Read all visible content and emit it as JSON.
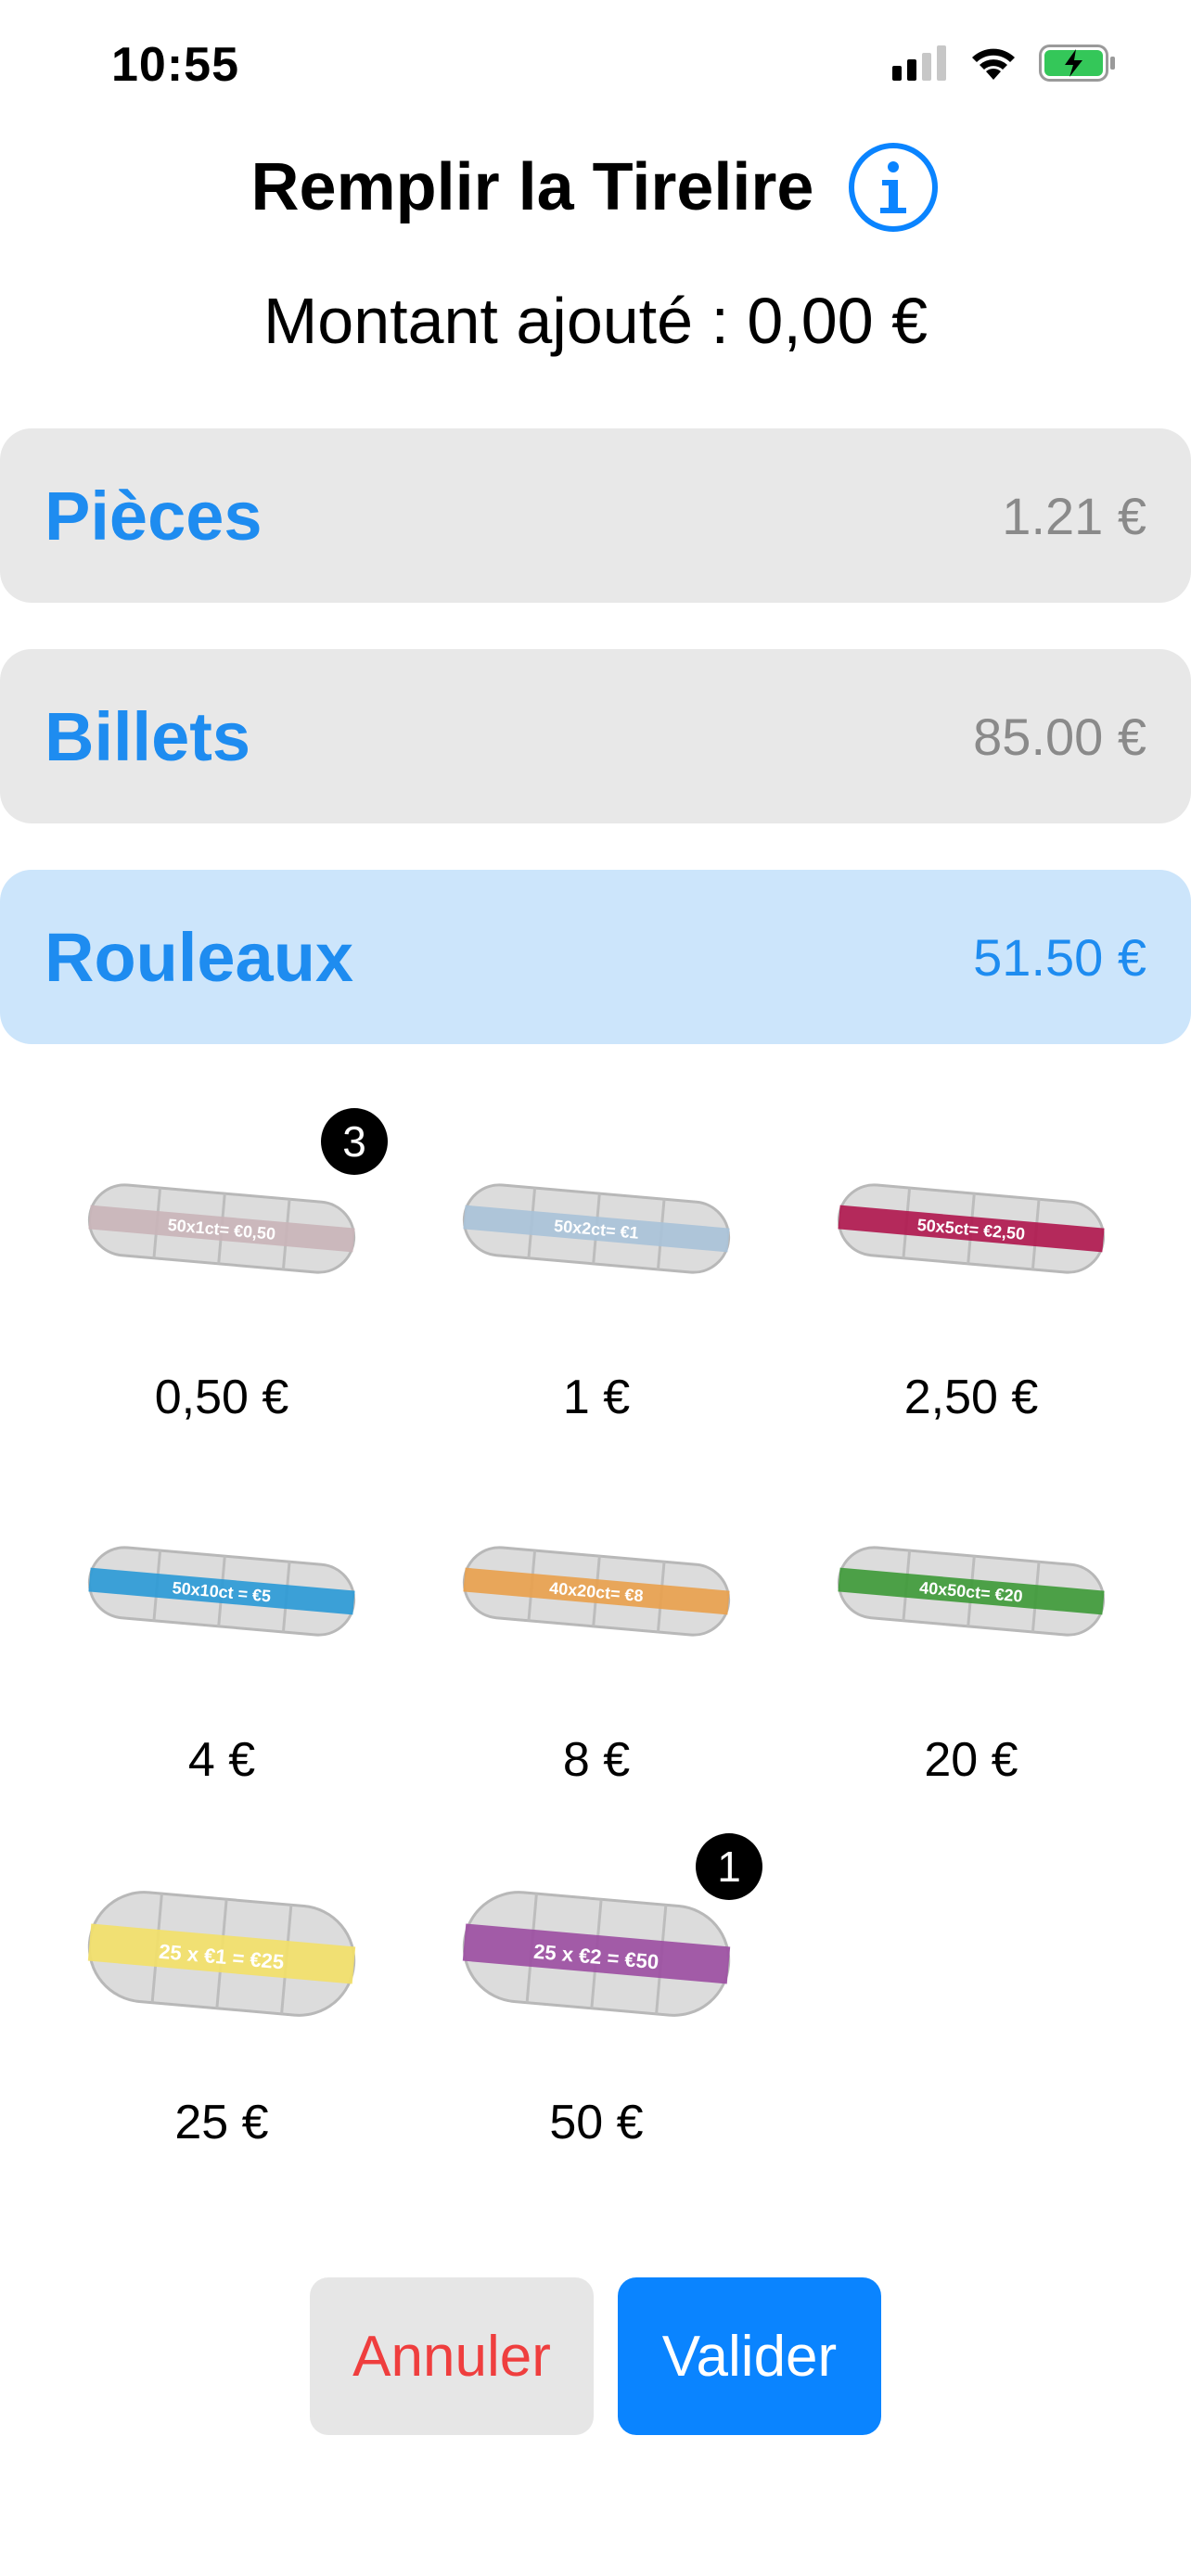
{
  "status_bar": {
    "time": "10:55"
  },
  "header": {
    "title": "Remplir la Tirelire",
    "amount_label": "Montant ajouté : 0,00 €"
  },
  "categories": [
    {
      "label": "Pièces",
      "amount": "1.21 €",
      "active": false
    },
    {
      "label": "Billets",
      "amount": "85.00 €",
      "active": false
    },
    {
      "label": "Rouleaux",
      "amount": "51.50 €",
      "active": true
    }
  ],
  "rolls": [
    {
      "label": "0,50 €",
      "band_color": "#c9b4b8",
      "band_text": "50x1ct= €0,50",
      "badge": "3"
    },
    {
      "label": "1 €",
      "band_color": "#a9c2d8",
      "band_text": "50x2ct= €1",
      "badge": null
    },
    {
      "label": "2,50 €",
      "band_color": "#b0194f",
      "band_text": "50x5ct= €2,50",
      "badge": null
    },
    {
      "label": "4 €",
      "band_color": "#2c9ad6",
      "band_text": "50x10ct = €5",
      "badge": null
    },
    {
      "label": "8 €",
      "band_color": "#e8a14e",
      "band_text": "40x20ct= €8",
      "badge": null
    },
    {
      "label": "20 €",
      "band_color": "#3f9a3a",
      "band_text": "40x50ct= €20",
      "badge": null
    },
    {
      "label": "25 €",
      "band_color": "#f2e069",
      "band_text": "25 x €1 = €25",
      "badge": null
    },
    {
      "label": "50 €",
      "band_color": "#9c4fa2",
      "band_text": "25 x €2 = €50",
      "badge": "1"
    }
  ],
  "buttons": {
    "cancel": "Annuler",
    "validate": "Valider"
  },
  "colors": {
    "accent": "#0a84ff",
    "active_panel": "#cce5fb",
    "panel": "#e8e8e8",
    "cancel_text": "#ef3e3e"
  },
  "icons": {
    "info": "info-icon",
    "signal": "cellular-signal-icon",
    "wifi": "wifi-icon",
    "battery": "battery-charging-icon"
  }
}
